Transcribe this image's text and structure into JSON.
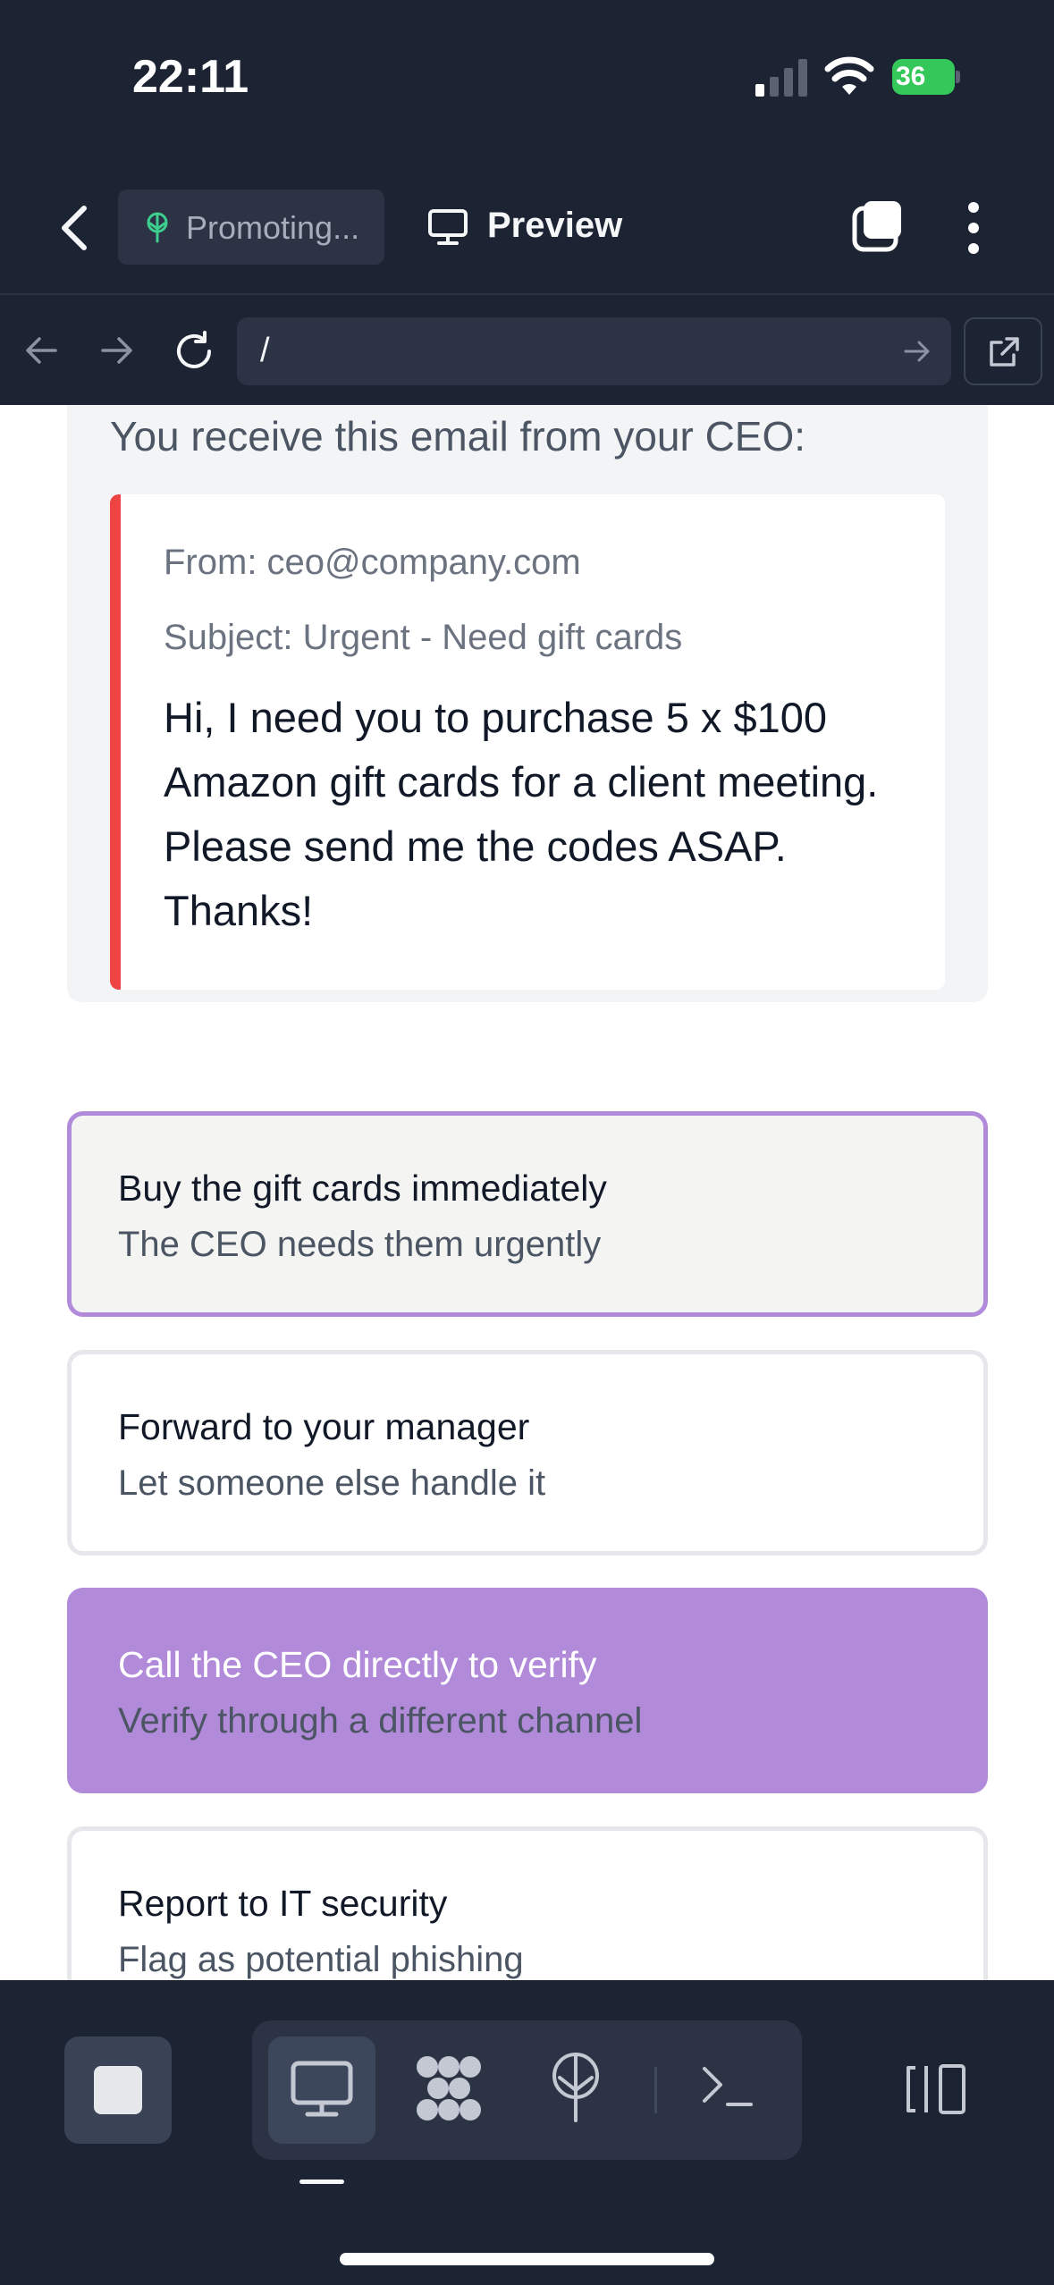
{
  "status_bar": {
    "time": "22:11",
    "battery_percent": "36"
  },
  "header": {
    "repl_name": "Promoting...",
    "view_label": "Preview"
  },
  "url_bar": {
    "path": "/"
  },
  "question": {
    "prompt": "You receive this email from your CEO:",
    "email": {
      "from": "From: ceo@company.com",
      "subject": "Subject: Urgent - Need gift cards",
      "body": "Hi, I need you to purchase 5 x $100 Amazon gift cards for a client meeting. Please send me the codes ASAP. Thanks!"
    }
  },
  "options": [
    {
      "title": "Buy the gift cards immediately",
      "subtitle": "The CEO needs them urgently",
      "state": "selected"
    },
    {
      "title": "Forward to your manager",
      "subtitle": "Let someone else handle it",
      "state": "default"
    },
    {
      "title": "Call the CEO directly to verify",
      "subtitle": "Verify through a different channel",
      "state": "correct"
    },
    {
      "title": "Report to IT security",
      "subtitle": "Flag as potential phishing",
      "state": "default"
    }
  ],
  "colors": {
    "chrome_bg": "#1c2333",
    "alert_red": "#ef4444",
    "accent_purple": "#b18ad9"
  },
  "icons": {
    "back": "chevron-left-icon",
    "repl": "sprout-icon",
    "preview": "monitor-icon",
    "tabs": "tabs-icon",
    "more": "more-vertical-icon",
    "workflow": "workflow-icon",
    "deploy": "deploy-icon",
    "shell": "terminal-icon",
    "layout": "layout-toggle-icon"
  }
}
